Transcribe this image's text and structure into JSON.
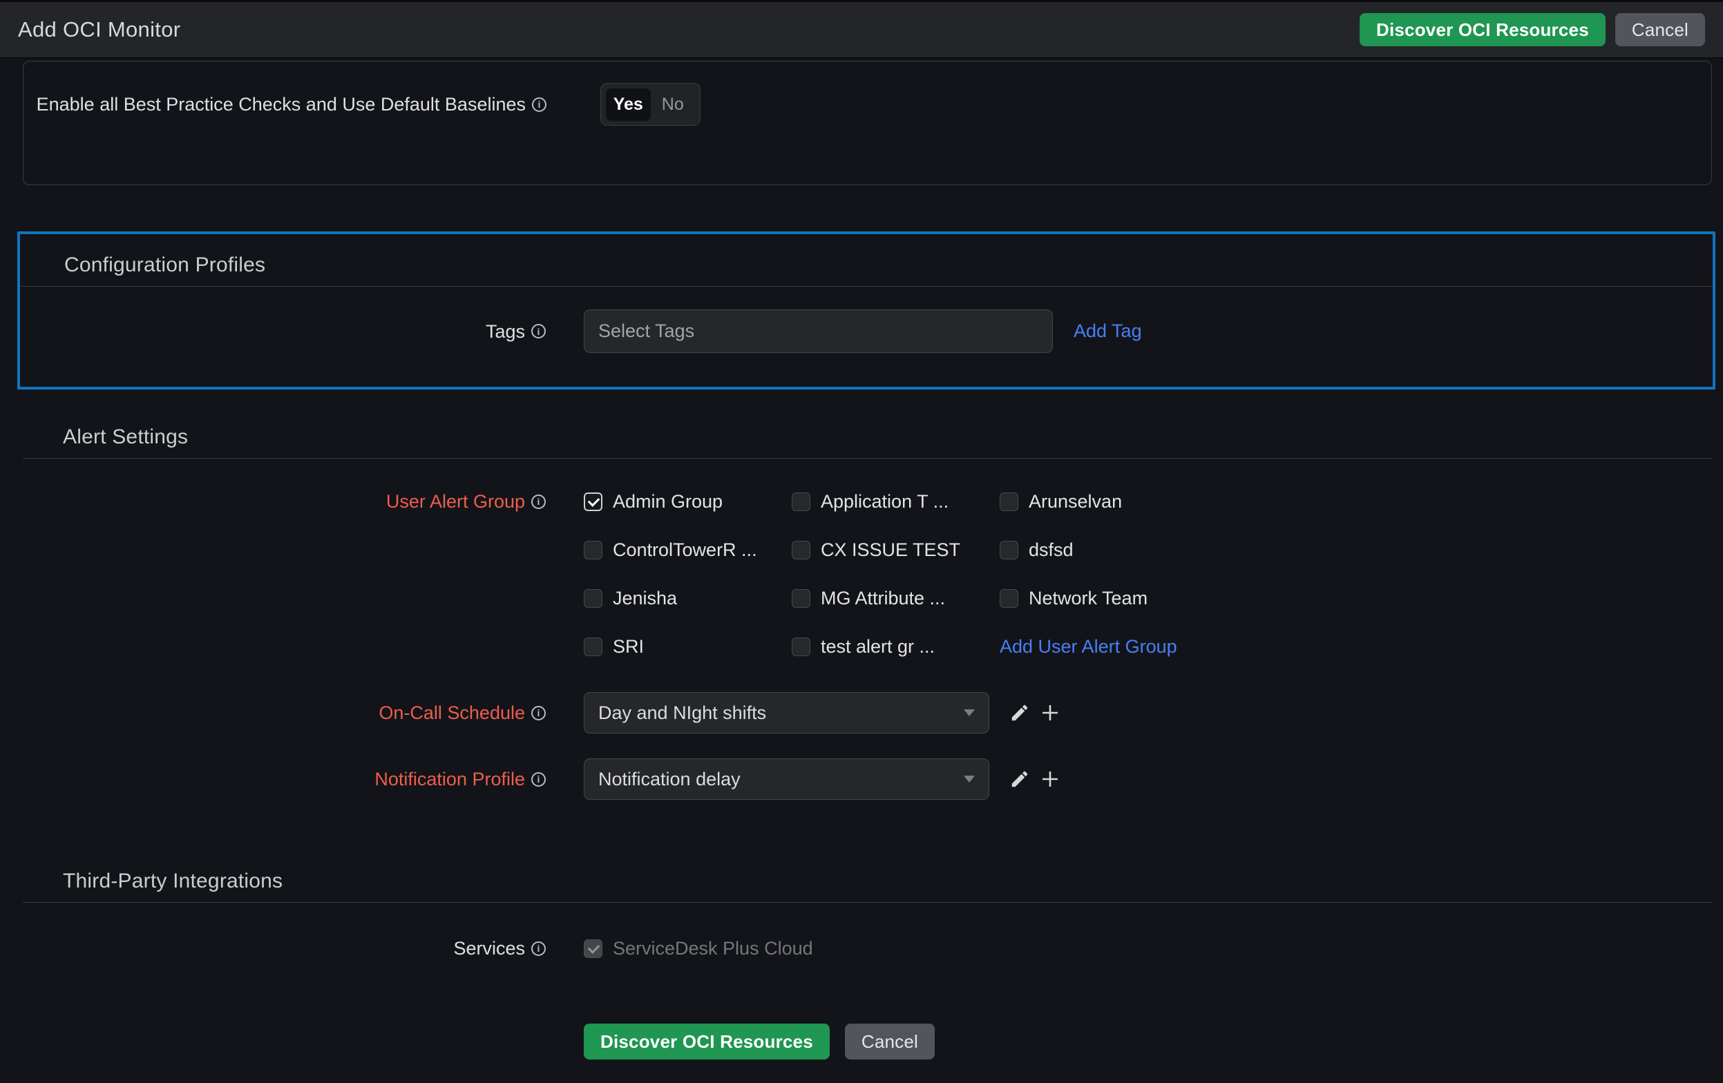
{
  "header": {
    "title": "Add OCI Monitor",
    "discover_button": "Discover OCI Resources",
    "cancel_button": "Cancel"
  },
  "best_practice": {
    "label": "Enable all Best Practice Checks and Use Default Baselines",
    "toggle": {
      "yes": "Yes",
      "no": "No",
      "selected": "Yes"
    }
  },
  "configuration_profiles": {
    "title": "Configuration Profiles",
    "tags_label": "Tags",
    "tags_placeholder": "Select Tags",
    "add_tag_link": "Add Tag"
  },
  "alert_settings": {
    "title": "Alert Settings",
    "user_alert_group_label": "User Alert Group",
    "groups": [
      {
        "label": "Admin Group",
        "checked": true
      },
      {
        "label": "Application T ...",
        "checked": false
      },
      {
        "label": "Arunselvan",
        "checked": false
      },
      {
        "label": "ControlTowerR ...",
        "checked": false
      },
      {
        "label": "CX ISSUE TEST",
        "checked": false
      },
      {
        "label": "dsfsd",
        "checked": false
      },
      {
        "label": "Jenisha",
        "checked": false
      },
      {
        "label": "MG Attribute ...",
        "checked": false
      },
      {
        "label": "Network Team",
        "checked": false
      },
      {
        "label": "SRI",
        "checked": false
      },
      {
        "label": "test alert gr ...",
        "checked": false
      }
    ],
    "add_user_alert_group_link": "Add User Alert Group",
    "on_call_schedule_label": "On-Call Schedule",
    "on_call_schedule_value": "Day and NIght shifts",
    "notification_profile_label": "Notification Profile",
    "notification_profile_value": "Notification delay"
  },
  "third_party": {
    "title": "Third-Party Integrations",
    "services_label": "Services",
    "service_item": "ServiceDesk Plus Cloud",
    "service_checked": true,
    "service_disabled": true
  },
  "footer": {
    "discover_button": "Discover OCI Resources",
    "cancel_button": "Cancel"
  },
  "icons": {
    "info": "i"
  },
  "colors": {
    "section_outline_blue": "#1173c2",
    "link_blue": "#4581f6",
    "required_label_red": "#ec5e4c",
    "primary_green": "#1f9652"
  }
}
